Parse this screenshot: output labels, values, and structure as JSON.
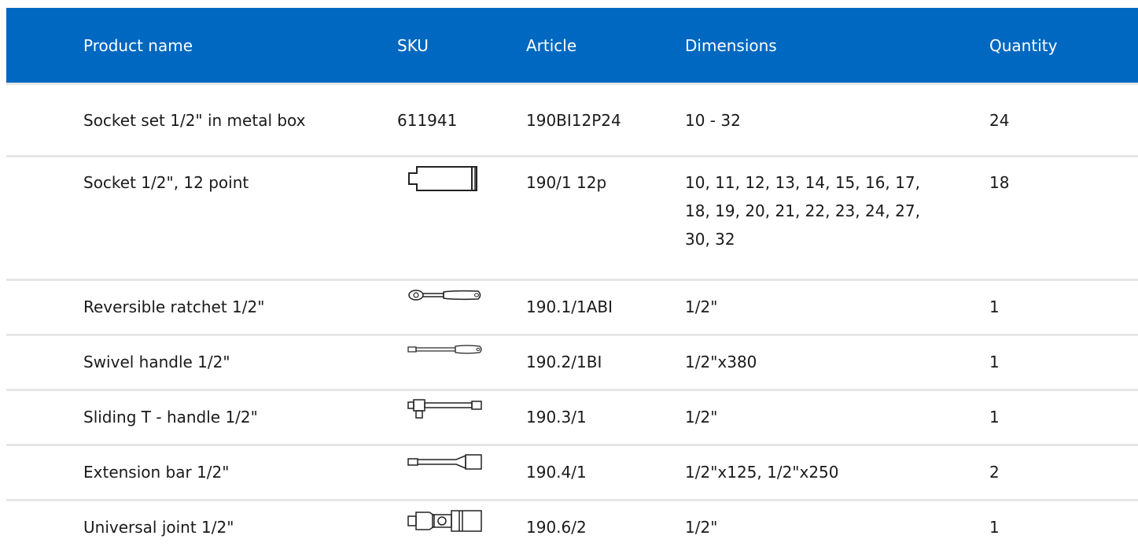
{
  "columns": {
    "name": "Product name",
    "sku": "SKU",
    "article": "Article",
    "dimensions": "Dimensions",
    "quantity": "Quantity"
  },
  "rows": [
    {
      "name": "Socket set 1/2\" in metal box",
      "sku": "611941",
      "icon": "",
      "article": "190BI12P24",
      "dimensions": "10 - 32",
      "quantity": "24"
    },
    {
      "name": "Socket 1/2\", 12 point",
      "sku": "",
      "icon": "socket-icon",
      "article": "190/1 12p",
      "dimensions": "10, 11, 12, 13, 14, 15, 16, 17, 18, 19, 20, 21, 22, 23, 24, 27, 30, 32",
      "quantity": "18"
    },
    {
      "name": "Reversible ratchet 1/2\"",
      "sku": "",
      "icon": "ratchet-icon",
      "article": "190.1/1ABI",
      "dimensions": "1/2\"",
      "quantity": "1"
    },
    {
      "name": "Swivel handle 1/2\"",
      "sku": "",
      "icon": "swivel-handle-icon",
      "article": "190.2/1BI",
      "dimensions": "1/2\"x380",
      "quantity": "1"
    },
    {
      "name": "Sliding T - handle 1/2\"",
      "sku": "",
      "icon": "t-handle-icon",
      "article": "190.3/1",
      "dimensions": "1/2\"",
      "quantity": "1"
    },
    {
      "name": "Extension bar 1/2\"",
      "sku": "",
      "icon": "extension-bar-icon",
      "article": "190.4/1",
      "dimensions": "1/2\"x125, 1/2\"x250",
      "quantity": "2"
    },
    {
      "name": "Universal joint 1/2\"",
      "sku": "",
      "icon": "universal-joint-icon",
      "article": "190.6/2",
      "dimensions": "1/2\"",
      "quantity": "1"
    }
  ],
  "colors": {
    "header_bg": "#0068c0",
    "header_text": "#ffffff",
    "row_divider": "#e6e6e6"
  }
}
